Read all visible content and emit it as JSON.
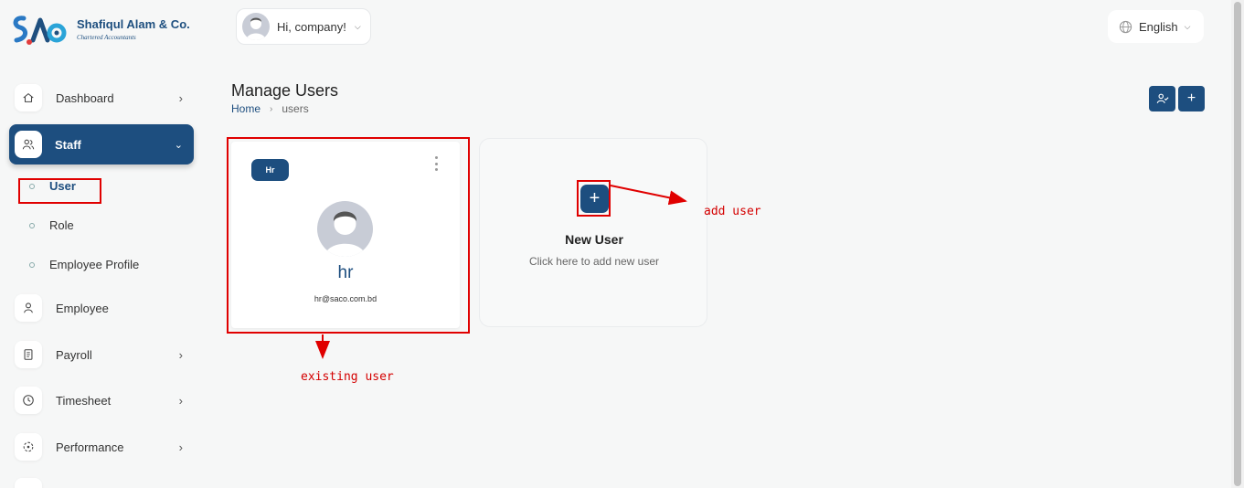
{
  "brand": {
    "name": "Shafiqul Alam & Co.",
    "tagline": "Chartered Accountants"
  },
  "header": {
    "greeting": "Hi, company!",
    "language": "English"
  },
  "sidebar": {
    "items": [
      {
        "label": "Dashboard",
        "icon": "home-icon",
        "has_arrow": true
      },
      {
        "label": "Staff",
        "icon": "users-icon",
        "active": true,
        "expanded": true
      },
      {
        "label": "Employee",
        "icon": "person-icon"
      },
      {
        "label": "Payroll",
        "icon": "receipt-icon",
        "has_arrow": true
      },
      {
        "label": "Timesheet",
        "icon": "clock-icon",
        "has_arrow": true
      },
      {
        "label": "Performance",
        "icon": "target-icon",
        "has_arrow": true
      }
    ],
    "staff_sub_items": [
      {
        "label": "User",
        "active": true
      },
      {
        "label": "Role"
      },
      {
        "label": "Employee Profile"
      }
    ]
  },
  "page": {
    "title": "Manage Users",
    "breadcrumb": [
      "Home",
      "users"
    ]
  },
  "users": [
    {
      "role_badge": "Hr",
      "name": "hr",
      "email": "hr@saco.com.bd"
    }
  ],
  "new_user_card": {
    "title": "New User",
    "subtitle": "Click here to add new user"
  },
  "annotations": {
    "add_user": "add user",
    "existing_user": "existing user"
  },
  "colors": {
    "primary": "#1d4e7f",
    "annotation": "#e00000",
    "background": "#f6f7f7"
  }
}
